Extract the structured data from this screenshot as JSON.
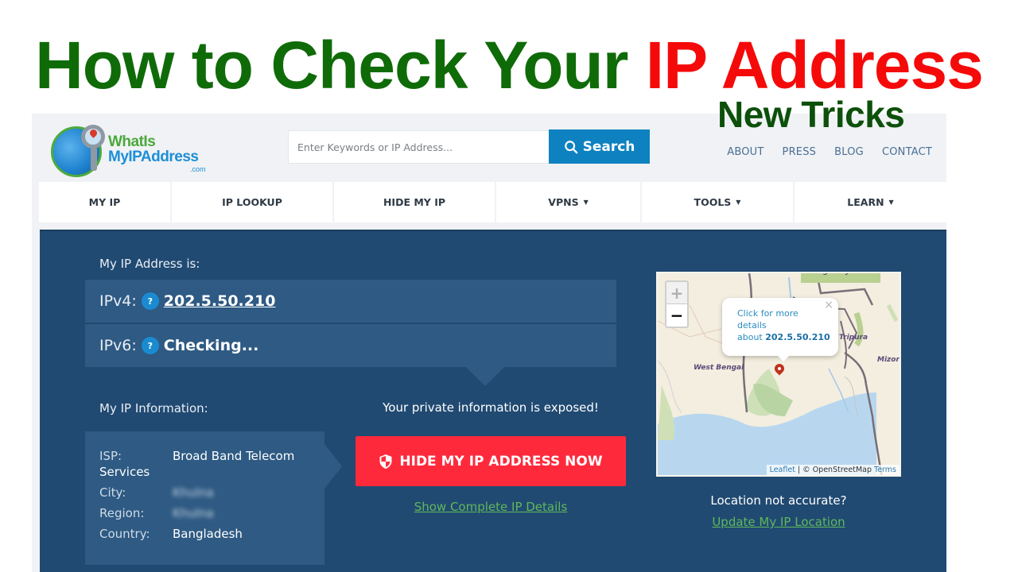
{
  "overlay": {
    "title_part1": "How to Check Your",
    "title_part2": "IP Address",
    "subtitle": "New Tricks",
    "colors": {
      "green": "#0f6b08",
      "red": "#f50a0a",
      "subtitle": "#0c500a"
    }
  },
  "header": {
    "logo": {
      "line1": "WhatIs",
      "line2": "MyIPAddress",
      "line3": ".com"
    },
    "search": {
      "placeholder": "Enter Keywords or IP Address...",
      "value": "",
      "button_label": "Search",
      "button_icon": "search-icon"
    },
    "links": [
      "ABOUT",
      "PRESS",
      "BLOG",
      "CONTACT"
    ]
  },
  "nav": {
    "items": [
      {
        "label": "MY IP",
        "dropdown": false
      },
      {
        "label": "IP LOOKUP",
        "dropdown": false
      },
      {
        "label": "HIDE MY IP",
        "dropdown": false
      },
      {
        "label": "VPNS",
        "dropdown": true
      },
      {
        "label": "TOOLS",
        "dropdown": true
      },
      {
        "label": "LEARN",
        "dropdown": true
      }
    ],
    "caret": "▼"
  },
  "main": {
    "ip_heading": "My IP Address is:",
    "ipv4": {
      "label": "IPv4:",
      "help": "?",
      "value": "202.5.50.210"
    },
    "ipv6": {
      "label": "IPv6:",
      "help": "?",
      "value": "Checking..."
    },
    "info_heading": "My IP Information:",
    "info": {
      "isp_label": "ISP:",
      "isp_value": "Broad Band Telecom",
      "isp_value_wrap": "Services",
      "city_label": "City:",
      "city_value": "Khulna",
      "region_label": "Region:",
      "region_value": "Khulna",
      "country_label": "Country:",
      "country_value": "Bangladesh"
    },
    "exposed_text": "Your private information is exposed!",
    "hide_button": "HIDE MY IP ADDRESS NOW",
    "details_link": "Show Complete IP Details",
    "location_question": "Location not accurate?",
    "location_link": "Update My IP Location"
  },
  "map": {
    "zoom_in": "+",
    "zoom_out": "−",
    "popup_line1": "Click for more",
    "popup_line2": "details",
    "popup_line3_prefix": "about",
    "popup_ip": "202.5.50.210",
    "popup_close": "×",
    "labels": [
      "West Bengal",
      "Tripura",
      "Mizora",
      "Meghalaya"
    ],
    "attribution_leaflet": "Leaflet",
    "attribution_sep": " | © OpenStreetMap ",
    "attribution_terms": "Terms"
  },
  "colors": {
    "panel_bg": "#214a72",
    "row_bg": "#2e5a83",
    "search_button": "#0e82c0",
    "hide_button": "#fe2a3c",
    "link_green": "#5fb85a",
    "help_badge": "#1a8bd0"
  }
}
